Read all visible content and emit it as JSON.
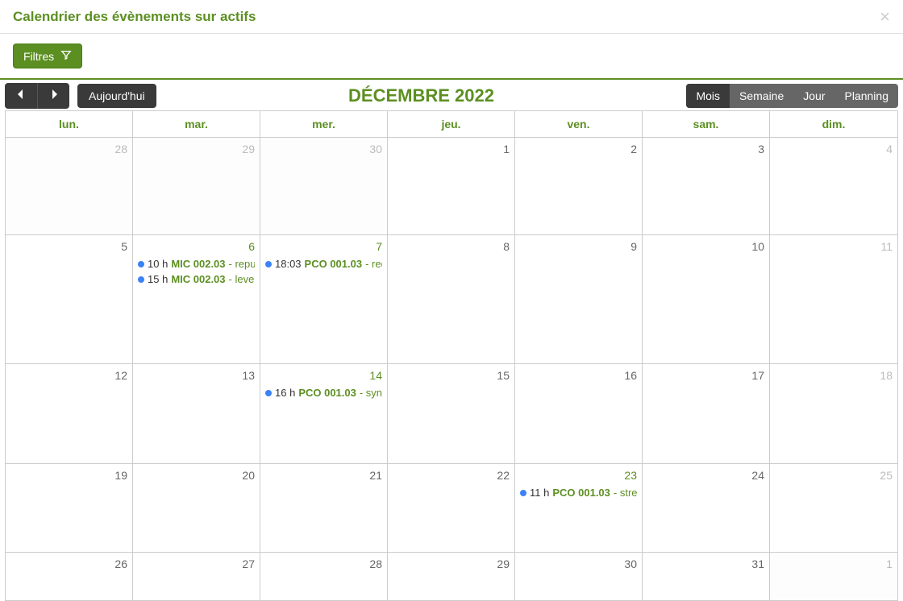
{
  "header": {
    "title": "Calendrier des évènements sur actifs"
  },
  "toolbar": {
    "filters_label": "Filtres"
  },
  "calendar": {
    "title": "DÉCEMBRE 2022",
    "today_label": "Aujourd'hui",
    "views": {
      "month": "Mois",
      "week": "Semaine",
      "day": "Jour",
      "planning": "Planning"
    },
    "day_headers": [
      "lun.",
      "mar.",
      "mer.",
      "jeu.",
      "ven.",
      "sam.",
      "dim."
    ]
  },
  "days": {
    "w0d0": "28",
    "w0d1": "29",
    "w0d2": "30",
    "w0d3": "1",
    "w0d4": "2",
    "w0d5": "3",
    "w0d6": "4",
    "w1d0": "5",
    "w1d1": "6",
    "w1d2": "7",
    "w1d3": "8",
    "w1d4": "9",
    "w1d5": "10",
    "w1d6": "11",
    "w2d0": "12",
    "w2d1": "13",
    "w2d2": "14",
    "w2d3": "15",
    "w2d4": "16",
    "w2d5": "17",
    "w2d6": "18",
    "w3d0": "19",
    "w3d1": "20",
    "w3d2": "21",
    "w3d3": "22",
    "w3d4": "23",
    "w3d5": "24",
    "w3d6": "25",
    "w4d0": "26",
    "w4d1": "27",
    "w4d2": "28",
    "w4d3": "29",
    "w4d4": "30",
    "w4d5": "31",
    "w4d6": "1"
  },
  "events": {
    "dec6_1": {
      "time": "10 h",
      "code": "MIC 002.03",
      "desc": " - repurp"
    },
    "dec6_2": {
      "time": "15 h",
      "code": "MIC 002.03",
      "desc": " - levera"
    },
    "dec7_1": {
      "time": "18:03",
      "code": "PCO 001.03",
      "desc": " - rede"
    },
    "dec14_1": {
      "time": "16 h",
      "code": "PCO 001.03",
      "desc": " - syner"
    },
    "dec23_1": {
      "time": "11 h",
      "code": "PCO 001.03",
      "desc": " - strea"
    }
  }
}
